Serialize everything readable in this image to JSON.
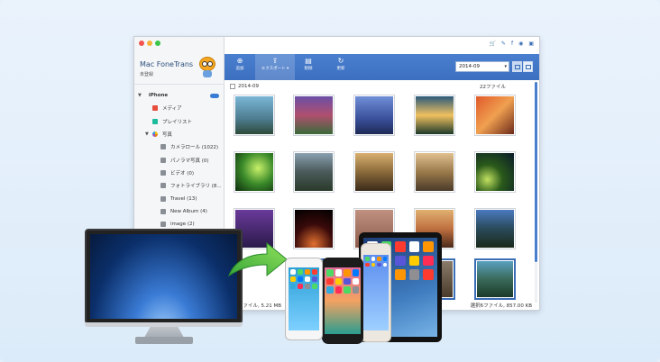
{
  "app": {
    "brand": "Mac FoneTrans",
    "registration_status": "未登録"
  },
  "sidebar": {
    "device": "iPhone",
    "items": [
      {
        "label": "メディア",
        "level": 1,
        "icon": "media-icon"
      },
      {
        "label": "プレイリスト",
        "level": 1,
        "icon": "playlist-icon"
      },
      {
        "label": "写真",
        "level": 1,
        "icon": "photos-icon"
      },
      {
        "label": "カメラロール (1022)",
        "level": 2,
        "icon": "album-icon"
      },
      {
        "label": "パノラマ写真 (0)",
        "level": 2,
        "icon": "album-icon"
      },
      {
        "label": "ビデオ (0)",
        "level": 2,
        "icon": "album-icon"
      },
      {
        "label": "フォトライブラリ (8...",
        "level": 2,
        "icon": "album-icon"
      },
      {
        "label": "Travel (13)",
        "level": 2,
        "icon": "album-icon"
      },
      {
        "label": "New Album (4)",
        "level": 2,
        "icon": "album-icon"
      },
      {
        "label": "image (2)",
        "level": 2,
        "icon": "album-icon"
      }
    ]
  },
  "toolbar": {
    "add_label": "追加",
    "export_label": "エクスポート",
    "delete_label": "削除",
    "refresh_label": "更新",
    "date_value": "2014-09"
  },
  "topbar_icons": [
    "cart-icon",
    "wrench-icon",
    "facebook-icon",
    "eye-icon",
    "share-icon"
  ],
  "group": {
    "date": "2014-09",
    "count": "22ファイル"
  },
  "status": {
    "left": "22ファイル, 5.21 MB",
    "right": "選択6ファイル, 857.00 KB"
  },
  "colors": {
    "toolbar": "#3c6fbf",
    "accent": "#3a6db5"
  }
}
